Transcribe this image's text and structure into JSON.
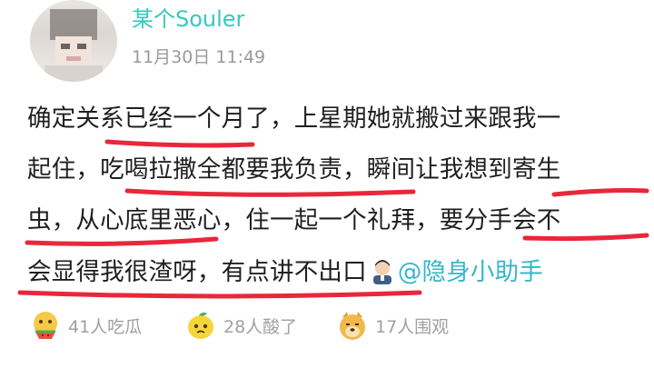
{
  "post": {
    "username": "某个Souler",
    "timestamp": "11月30日 11:49",
    "lines": [
      "确定关系已经一个月了，上星期她就搬过来跟我一",
      "起住，吃喝拉撒全都要我负责，瞬间让我想到寄生",
      "虫，从心底里恶心，住一起一个礼拜，要分手会不",
      "会显得我很渣呀，有点讲不出口"
    ],
    "mention": "@隐身小助手"
  },
  "reactions": [
    {
      "icon": "eating-melon-emoji-icon",
      "label": "41人吃瓜"
    },
    {
      "icon": "sour-lemon-emoji-icon",
      "label": "28人酸了"
    },
    {
      "icon": "dog-face-emoji-icon",
      "label": "17人围观"
    }
  ],
  "colors": {
    "username": "#35c9c0",
    "mention": "#35b7c8",
    "underline": "#e8283a",
    "meta": "#9a9a9a"
  }
}
